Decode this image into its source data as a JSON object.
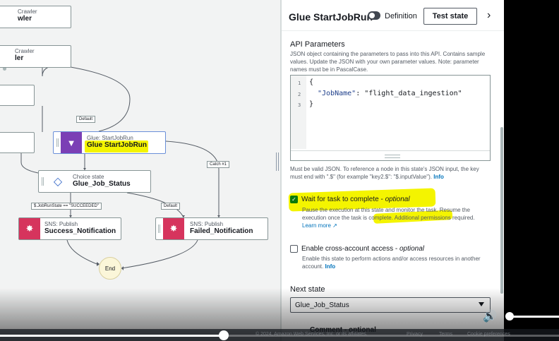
{
  "canvas": {
    "nodes": {
      "crawler_top": {
        "type": "Crawler",
        "name": "wler"
      },
      "crawler_second": {
        "type": "Crawler",
        "name": "ler"
      },
      "glue_job": {
        "type": "Glue: StartJobRun",
        "name": "Glue StartJobRun"
      },
      "choice": {
        "type": "Choice state",
        "name": "Glue_Job_Status"
      },
      "sns_success": {
        "type": "SNS: Publish",
        "name": "Success_Notification"
      },
      "sns_failed": {
        "type": "SNS: Publish",
        "name": "Failed_Notification"
      },
      "end": "End"
    },
    "edge_labels": {
      "default_top": "Default",
      "catch": "Catch #1",
      "condition": "$.JobRunState == \"SUCCEEDED\"",
      "default_choice": "Default"
    },
    "icons": {
      "back": "chevron-left-icon",
      "glue": "glue-icon",
      "choice": "choice-icon",
      "sns": "sns-icon"
    }
  },
  "panel": {
    "title": "Glue StartJobRun",
    "toggle_label": "Definition",
    "test_button": "Test state",
    "api_params": {
      "title": "API Parameters",
      "description": "JSON object containing the parameters to pass into this API. Contains sample values. Update the JSON with your own parameter values. Note: parameter names must be in PascalCase.",
      "code_lines": [
        "1",
        "2",
        "3"
      ],
      "code_open": "{",
      "code_key": "\"JobName\"",
      "code_value": ": \"flight_data_ingestion\"",
      "code_close": "}",
      "help": "Must be valid JSON. To reference a node in this state's JSON input, the key must end with \".$\" (for example \"key2.$\": \"$.inputValue\").",
      "info": "Info"
    },
    "wait_task": {
      "label": "Wait for task to complete - ",
      "label_optional": "optional",
      "checked": true,
      "description": "Pause the execution at this state and monitor the task. Resume the execution once the task is complete. Additional permissions required.",
      "learn_more": "Learn more"
    },
    "cross_account": {
      "label": "Enable cross-account access - ",
      "label_optional": "optional",
      "checked": false,
      "description": "Enable this state to perform actions and/or access resources in another account.",
      "info": "Info"
    },
    "next_state": {
      "title": "Next state",
      "selected": "Glue_Job_Status"
    },
    "comment": {
      "label": "Comment - optional"
    }
  },
  "footer": {
    "copyright": "© 2024, Amazon Web Services, Inc. or its affiliates.",
    "privacy": "Privacy",
    "terms": "Terms",
    "cookies": "Cookie preferences"
  },
  "video": {
    "progress": 0.4,
    "volume": 1.0
  },
  "colors": {
    "highlight": "#f4f400",
    "glue_purple": "#7b3fb5",
    "sns_red": "#d6345d",
    "link_blue": "#0073bb"
  }
}
